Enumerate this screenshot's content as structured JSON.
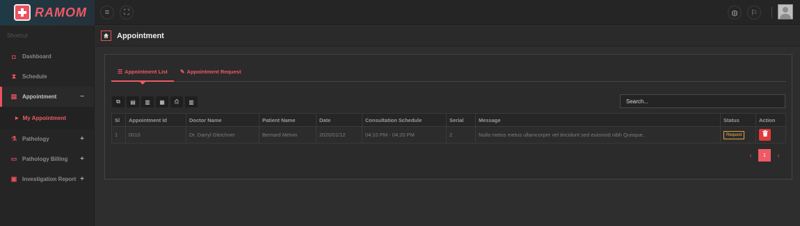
{
  "app": {
    "name": "RAMOM"
  },
  "topbar": {
    "menu_icon": "≡",
    "fullscreen_icon": "⛶",
    "globe_icon": "◍",
    "flag_icon": "⚐"
  },
  "sidebar": {
    "shortcut": "Shortcut",
    "items": [
      {
        "label": "Dashboard",
        "icon": "◘",
        "toggle": ""
      },
      {
        "label": "Schedule",
        "icon": "⧗",
        "toggle": ""
      },
      {
        "label": "Appointment",
        "icon": "▤",
        "toggle": "−"
      },
      {
        "label": "Pathology",
        "icon": "⚗",
        "toggle": "+"
      },
      {
        "label": "Pathology Billing",
        "icon": "▭",
        "toggle": "+"
      },
      {
        "label": "Investigation Report",
        "icon": "▣",
        "toggle": "+"
      }
    ],
    "sub_items": [
      {
        "label": "My Appointment"
      }
    ]
  },
  "page": {
    "title": "Appointment"
  },
  "tabs": [
    {
      "label": "Appointment List",
      "icon": "☰"
    },
    {
      "label": "Appointment Request",
      "icon": "✎"
    }
  ],
  "toolbar": {
    "buttons": [
      "⧉",
      "▤",
      "▥",
      "▦",
      "⎙",
      "▥"
    ]
  },
  "search": {
    "placeholder": "Search..."
  },
  "table": {
    "headers": [
      "Sl",
      "Appointment Id",
      "Doctor Name",
      "Patient Name",
      "Date",
      "Consultation Schedule",
      "Serial",
      "Message",
      "Status",
      "Action"
    ],
    "rows": [
      {
        "sl": "1",
        "id": "0010",
        "doctor": "Dr. Darryl Gleichner",
        "patient": "Bernard Melvin",
        "date": "2020/01/12",
        "schedule": "04:10 PM - 04:20 PM",
        "serial": "2",
        "message": "Nulla metus metus ullamcorper vel tincidunt sed euismod nibh Quisque.",
        "status": "Request",
        "action_icon": "🗑"
      }
    ]
  },
  "pagination": {
    "prev": "‹",
    "current": "1",
    "next": "›"
  },
  "colors": {
    "accent": "#ee5a66",
    "status_border": "#e8a33d",
    "delete": "#e03b3b"
  }
}
